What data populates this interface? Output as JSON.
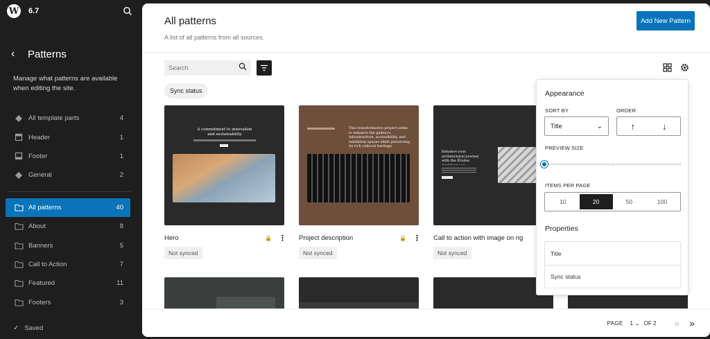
{
  "topbar": {
    "logo": "W",
    "version": "6.7"
  },
  "sidebar": {
    "title": "Patterns",
    "description": "Manage what patterns are available when editing the site.",
    "groups": [
      {
        "label": "All template parts",
        "count": "4",
        "icon": "diamond-icon"
      },
      {
        "label": "Header",
        "count": "1",
        "icon": "header-icon"
      },
      {
        "label": "Footer",
        "count": "1",
        "icon": "footer-icon"
      },
      {
        "label": "General",
        "count": "2",
        "icon": "diamond-icon"
      }
    ],
    "categories": [
      {
        "label": "All patterns",
        "count": "40"
      },
      {
        "label": "About",
        "count": "8"
      },
      {
        "label": "Banners",
        "count": "5"
      },
      {
        "label": "Call to Action",
        "count": "7"
      },
      {
        "label": "Featured",
        "count": "11"
      },
      {
        "label": "Footers",
        "count": "3"
      }
    ],
    "saved": "Saved"
  },
  "main": {
    "title": "All patterns",
    "subtitle": "A list of all patterns from all sources.",
    "add_button": "Add New Pattern",
    "search_placeholder": "Search",
    "filter_chip": "Sync status",
    "cards": [
      {
        "title": "Hero",
        "status": "Not synced",
        "thumb_heading": "A commitment to innovation and sustainability"
      },
      {
        "title": "Project description",
        "status": "Not synced",
        "thumb_heading": "This transformative project seeks to enhance the gallery's infrastructure, accessibility, and exhibition spaces while preserving its rich cultural heritage."
      },
      {
        "title": "Call to action with image on rig",
        "status": "Not synced",
        "thumb_heading": "Enhance your architectural journey with the Études Architect app."
      }
    ],
    "pagination": {
      "label": "PAGE",
      "current": "1",
      "total": "OF 2"
    }
  },
  "popover": {
    "appearance_title": "Appearance",
    "sort_by_label": "SORT BY",
    "sort_by_value": "Title",
    "order_label": "ORDER",
    "preview_size_label": "PREVIEW SIZE",
    "preview_size_value": 0,
    "items_per_page_label": "ITEMS PER PAGE",
    "items_per_page_options": [
      "10",
      "20",
      "50",
      "100"
    ],
    "items_per_page_selected": "20",
    "properties_title": "Properties",
    "properties": [
      "Title",
      "Sync status"
    ]
  },
  "colors": {
    "accent": "#0a74ba",
    "sidebar_bg": "#1e1e1e",
    "card_bg": "#2a2a2a",
    "brown_card": "#6e4f3a"
  }
}
